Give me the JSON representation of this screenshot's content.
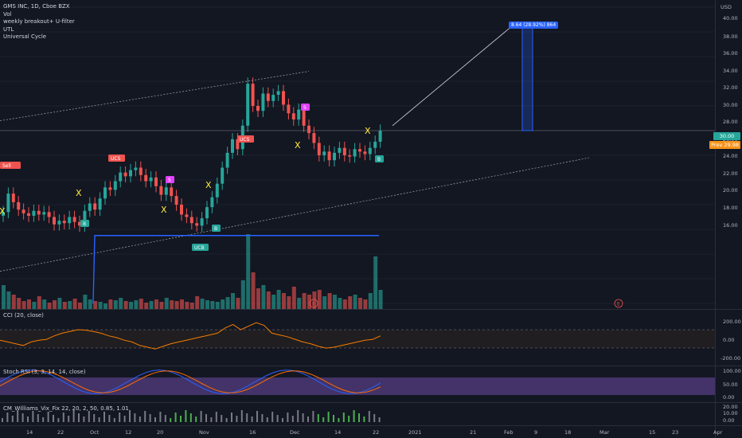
{
  "legend": {
    "title": "GMS INC, 1D, Cboe BZX",
    "lines": [
      "Vol",
      "weekly breakout+ U-filter",
      "UTL",
      "Universal Cycle"
    ]
  },
  "currency": "USD",
  "price_axis": [
    "40.00",
    "38.00",
    "36.00",
    "34.00",
    "32.00",
    "30.00",
    "28.00",
    "26.00",
    "24.00",
    "22.00",
    "20.00",
    "18.00",
    "16.00"
  ],
  "price_tags": {
    "last": {
      "value": "30.00",
      "color": "#26a69a"
    },
    "prev": {
      "value": "29.98",
      "color": "#f7931a"
    },
    "prev_label": "Prev"
  },
  "measure_label": "8.64 (28.92%) 864",
  "signal_labels": {
    "sell": "Sell",
    "ucs": "UCS",
    "ucb": "UCB",
    "b": "B",
    "s": "S",
    "x": "X",
    "earnings": "E"
  },
  "cci": {
    "label": "CCI (20, close)",
    "axis": [
      "200.00",
      "0.00",
      "-200.00"
    ]
  },
  "stoch": {
    "label": "Stoch RSI (3, 3, 14, 14, close)",
    "axis": [
      "100.00",
      "50.00",
      "0.00"
    ]
  },
  "wvf": {
    "label": "CM_Williams_Vix_Fix 22, 20, 2, 50, 0.85, 1.01",
    "axis": [
      "20.00",
      "10.00",
      "0.00"
    ]
  },
  "time_axis": [
    "14",
    "22",
    "Oct",
    "12",
    "20",
    "Nov",
    "16",
    "Dec",
    "14",
    "22",
    "2021",
    "21",
    "Feb",
    "9",
    "18",
    "Mar",
    "15",
    "23",
    "Apr"
  ],
  "colors": {
    "up": "#26a69a",
    "down": "#ef5350",
    "cci_line": "#f57c00",
    "stoch_k": "#2962ff",
    "stoch_d": "#ff6d00",
    "stoch_band": "#7e57c2"
  }
}
